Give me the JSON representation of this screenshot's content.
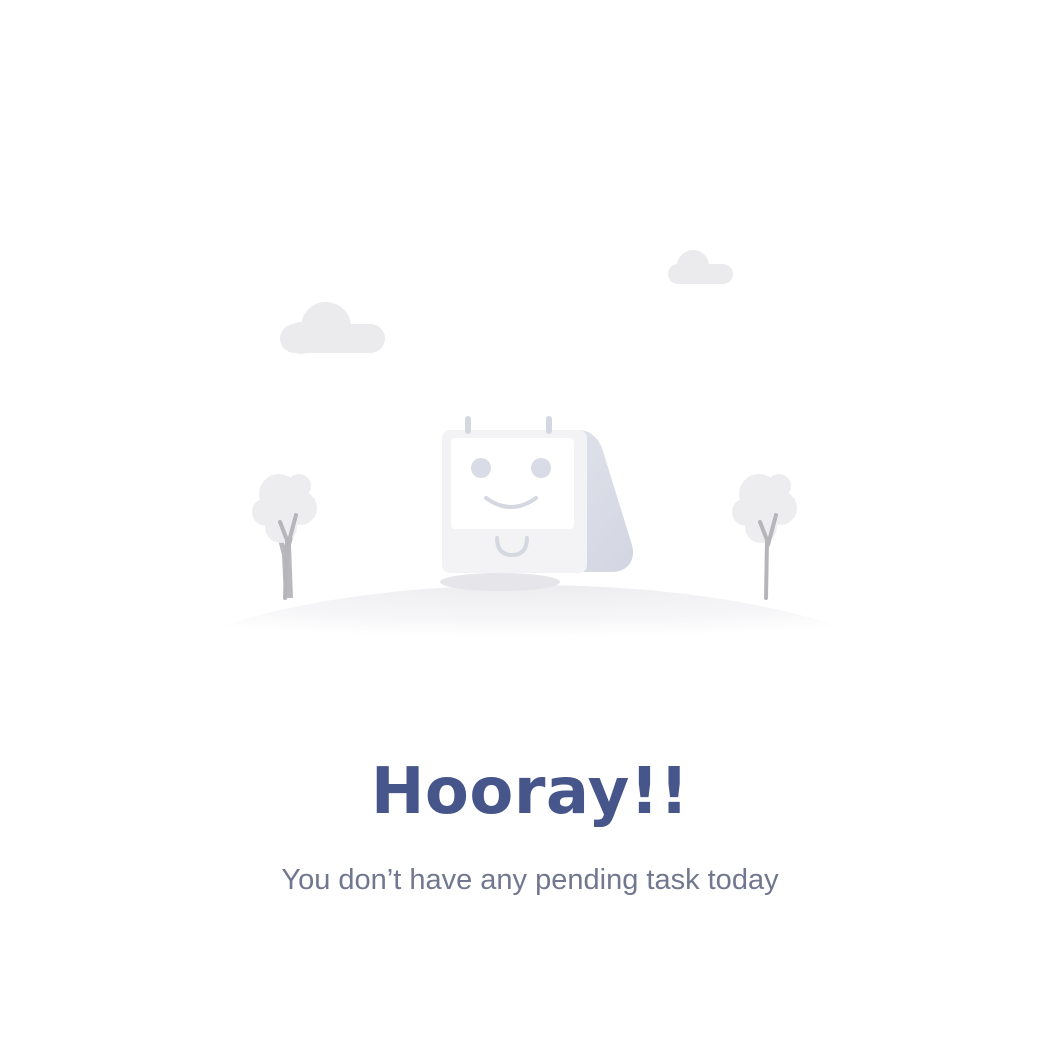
{
  "empty_state": {
    "headline": "Hooray!!",
    "message": "You don’t have any pending task today",
    "illustration": {
      "icons": [
        "cloud-icon",
        "tree-icon",
        "calendar-face-icon",
        "hill-icon"
      ]
    }
  },
  "colors": {
    "background": "#ffffff",
    "headline": "#46558a",
    "message": "#71778f",
    "illustration_light": "#f0f0f3",
    "illustration_mid": "#d9dbe6",
    "tree_trunk": "#b8b8bc"
  }
}
